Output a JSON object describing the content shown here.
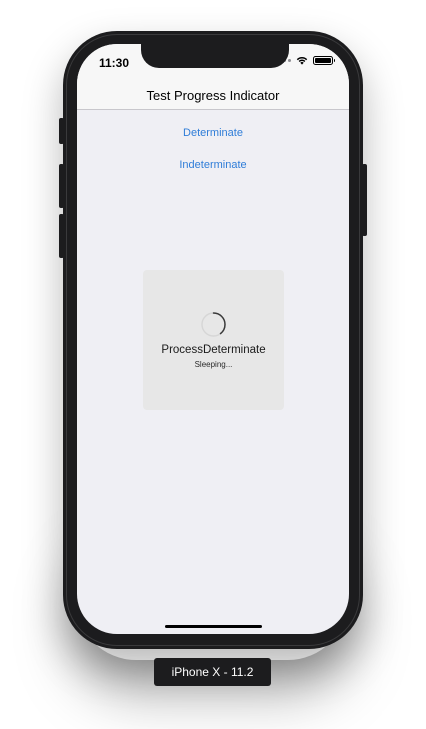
{
  "status_bar": {
    "time": "11:30"
  },
  "nav": {
    "title": "Test Progress Indicator"
  },
  "buttons": {
    "determinate": "Determinate",
    "indeterminate": "Indeterminate"
  },
  "hud": {
    "title": "ProcessDeterminate",
    "detail": "Sleeping..."
  },
  "simulator": {
    "device_label": "iPhone X - 11.2"
  },
  "colors": {
    "accent": "#2f7dd8",
    "screen_background": "#efeff4",
    "hud_background": "#e7e7e7",
    "device_frame": "#1c1c1e"
  },
  "icons": {
    "spinner": "activity-spinner-icon",
    "wifi": "wifi-icon",
    "battery": "battery-icon",
    "signal": "signal-dots-icon"
  }
}
